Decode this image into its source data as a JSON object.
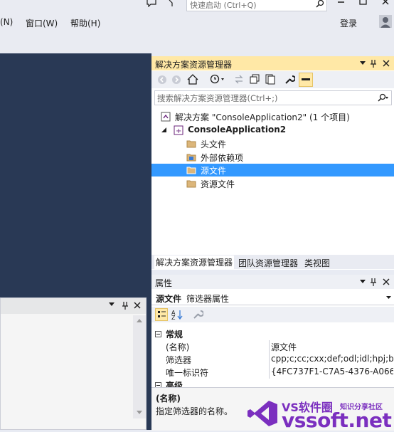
{
  "titlebar": {
    "quick_launch_placeholder": "快速启动 (Ctrl+Q)"
  },
  "menu": {
    "items": [
      "(N)",
      "窗口(W)",
      "帮助(H)"
    ],
    "login": "登录"
  },
  "solution_explorer": {
    "title": "解决方案资源管理器",
    "search_placeholder": "搜索解决方案资源管理器(Ctrl+;)",
    "tree": [
      "解决方案 \"ConsoleApplication2\" (1 个项目)",
      "ConsoleApplication2",
      "头文件",
      "外部依赖项",
      "源文件",
      "资源文件"
    ],
    "tabs": [
      "解决方案资源管理器",
      "团队资源管理器",
      "类视图"
    ]
  },
  "properties": {
    "title": "属性",
    "object_name": "源文件",
    "object_type": "筛选器属性",
    "category_general": "常规",
    "category_advanced": "高级",
    "rows": [
      {
        "name": "(名称)",
        "value": "源文件"
      },
      {
        "name": "筛选器",
        "value": "cpp;c;cc;cxx;def;odl;idl;hpj;bat"
      },
      {
        "name": "唯一标识符",
        "value": "{4FC737F1-C7A5-4376-A066"
      }
    ],
    "desc_title": "(名称)",
    "desc_text": "指定筛选器的名称。"
  },
  "watermark": {
    "line1": "VS软件圈",
    "line1_sub": "知识分享社区",
    "line2": "vssoft.net"
  },
  "colors": {
    "accent_yellow": "#ffe8a6",
    "selection": "#3399ff",
    "editor_bg": "#293955",
    "watermark_purple": "#7b2fbf"
  }
}
